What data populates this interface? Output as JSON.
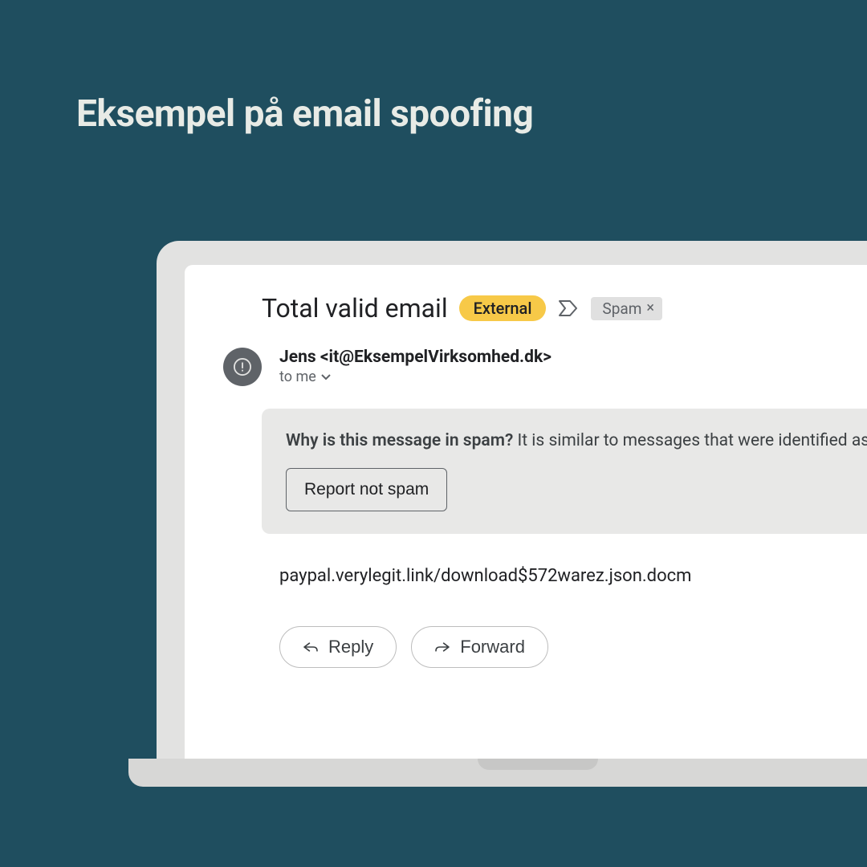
{
  "page": {
    "title": "Eksempel på email spoofing"
  },
  "email": {
    "subject": "Total valid email",
    "badges": {
      "external": "External",
      "spam_label": "Spam"
    },
    "sender": {
      "display": "Jens <it@EksempelVirksomhed.dk>",
      "recipient": "to me"
    },
    "spam_banner": {
      "question": "Why is this message in spam?",
      "explanation": "It is similar to messages that were identified as",
      "report_btn": "Report not spam"
    },
    "body": "paypal.verylegit.link/download$572warez.json.docm",
    "actions": {
      "reply": "Reply",
      "forward": "Forward"
    }
  }
}
